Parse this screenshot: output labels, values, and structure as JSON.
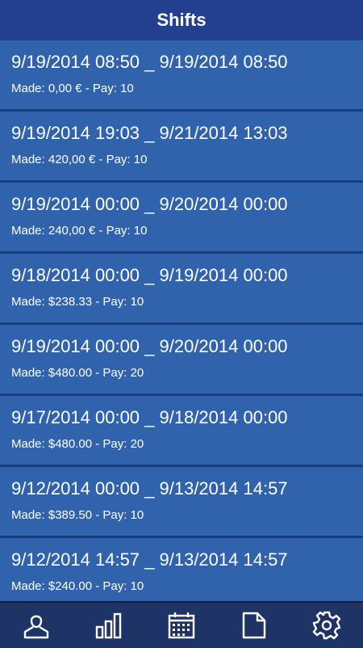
{
  "header": {
    "title": "Shifts"
  },
  "shifts": [
    {
      "range": "9/19/2014 08:50 _ 9/19/2014 08:50",
      "detail": "Made: 0,00 € - Pay: 10"
    },
    {
      "range": "9/19/2014 19:03 _ 9/21/2014 13:03",
      "detail": "Made: 420,00 € - Pay: 10"
    },
    {
      "range": "9/19/2014 00:00 _ 9/20/2014 00:00",
      "detail": "Made: 240,00 € - Pay: 10"
    },
    {
      "range": "9/18/2014 00:00 _ 9/19/2014 00:00",
      "detail": "Made: $238.33 - Pay: 10"
    },
    {
      "range": "9/19/2014 00:00 _ 9/20/2014 00:00",
      "detail": "Made: $480.00 - Pay: 20"
    },
    {
      "range": "9/17/2014 00:00 _ 9/18/2014 00:00",
      "detail": "Made: $480.00 - Pay: 20"
    },
    {
      "range": "9/12/2014 00:00 _ 9/13/2014 14:57",
      "detail": "Made: $389.50 - Pay: 10"
    },
    {
      "range": "9/12/2014 14:57 _ 9/13/2014 14:57",
      "detail": "Made: $240.00 - Pay: 10"
    }
  ],
  "tabbar": {
    "icons": [
      "profile-icon",
      "chart-icon",
      "calendar-icon",
      "document-icon",
      "gear-icon"
    ]
  },
  "colors": {
    "header": "#22408f",
    "row": "#3163ad",
    "row_divider": "#1f3b78",
    "tabbar": "#1f3466",
    "text": "#ffffff"
  }
}
